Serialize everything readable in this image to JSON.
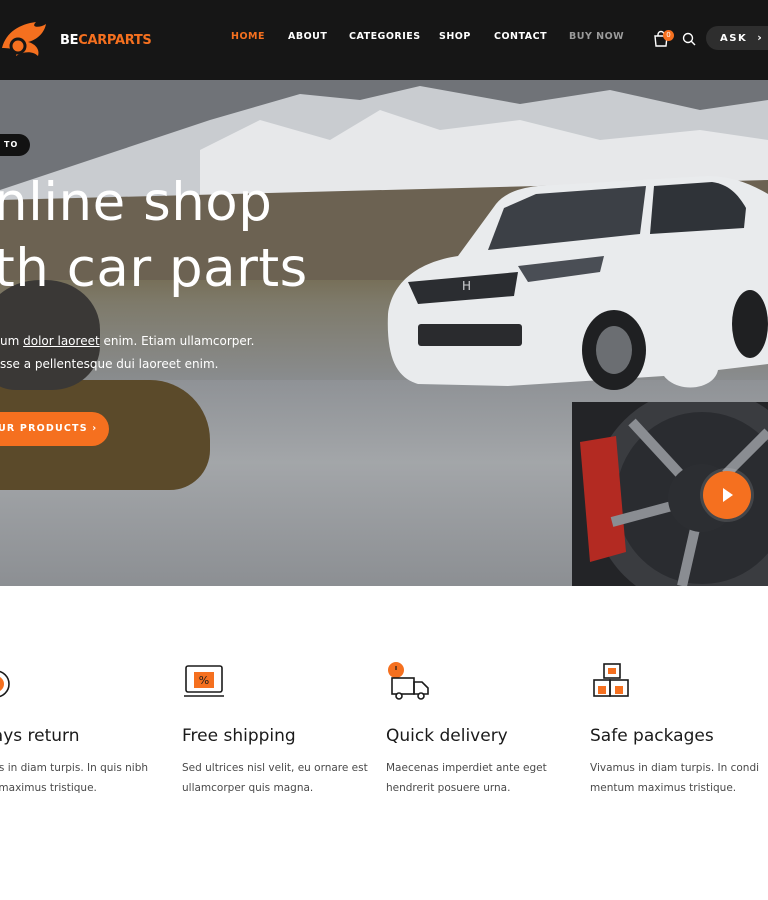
{
  "colors": {
    "accent": "#f5701f",
    "header_bg": "#161616",
    "text_dark": "#1a1a1a"
  },
  "header": {
    "logo_prefix": "BE",
    "logo_suffix": "CARPARTS",
    "nav": [
      {
        "label": "HOME",
        "active": true
      },
      {
        "label": "ABOUT"
      },
      {
        "label": "CATEGORIES"
      },
      {
        "label": "SHOP"
      },
      {
        "label": "CONTACT"
      },
      {
        "label": "BUY NOW"
      }
    ],
    "cart_count": "0",
    "cart_icon": "shopping-bag-icon",
    "search_icon": "search-icon",
    "ask_label": "ASK",
    "ask_chevron": "›"
  },
  "hero": {
    "tag": "TO",
    "title_line1": "nline shop",
    "title_line2": "th car parts",
    "text_line1_pre": "um ",
    "text_line1_link": "dolor laoreet",
    "text_line1_post": " enim. Etiam ullamcorper.",
    "text_line2": "sse a pellentesque dui laoreet enim.",
    "cta_label": "UR PRODUCTS ›",
    "video_play_icon": "play-icon"
  },
  "features": [
    {
      "icon": "stopwatch-icon",
      "title": "days return",
      "text": "mus in diam turpis. In quis nibh\nna maximus tristique."
    },
    {
      "icon": "laptop-discount-icon",
      "title": "Free shipping",
      "text": "Sed ultrices nisl velit, eu ornare est\nullamcorper quis magna."
    },
    {
      "icon": "delivery-truck-icon",
      "title": "Quick delivery",
      "text": "Maecenas imperdiet ante eget\nhendrerit posuere urna."
    },
    {
      "icon": "boxes-icon",
      "title": "Safe packages",
      "text": "Vivamus in diam turpis. In condi\nmentum maximus tristique."
    }
  ]
}
